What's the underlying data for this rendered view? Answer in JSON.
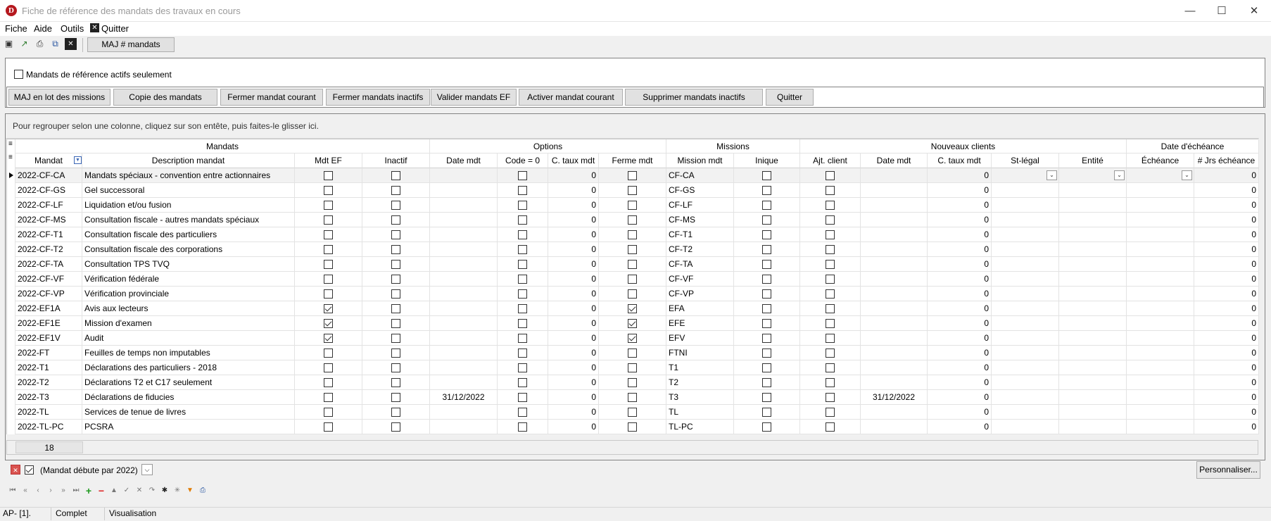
{
  "window": {
    "title": "Fiche de référence des mandats des travaux en cours",
    "logo": "D"
  },
  "menu": {
    "fiche": "Fiche",
    "aide": "Aide",
    "outils": "Outils",
    "quitter": "Quitter"
  },
  "toolbar": {
    "maj_label": "MAJ # mandats"
  },
  "filter": {
    "checkbox_label": "Mandats de référence actifs seulement",
    "checked": false
  },
  "actions": [
    "MAJ en lot des missions",
    "Copie des mandats",
    "Fermer mandat courant",
    "Fermer mandats inactifs",
    "Valider mandats EF",
    "Activer mandat courant",
    "Supprimer mandats inactifs",
    "Quitter"
  ],
  "grid": {
    "group_hint": "Pour regrouper selon une colonne, cliquez sur son entête, puis faites-le glisser ici.",
    "bands": [
      "Mandats",
      "Options",
      "Missions",
      "Nouveaux clients",
      "Date d'échéance"
    ],
    "columns": [
      "Mandat",
      "Description mandat",
      "Mdt EF",
      "Inactif",
      "Date mdt",
      "Code = 0",
      "C. taux mdt",
      "Ferme mdt",
      "Mission mdt",
      "Inique",
      "Ajt. client",
      "Date mdt",
      "C. taux mdt",
      "St-légal",
      "Entité",
      "Échéance",
      "# Jrs échéance"
    ],
    "rows": [
      {
        "mandat": "2022-CF-CA",
        "desc": "Mandats spéciaux - convention entre actionnaires",
        "ef": false,
        "date": "",
        "ferme": false,
        "mission": "CF-CA",
        "date2": ""
      },
      {
        "mandat": "2022-CF-GS",
        "desc": "Gel successoral",
        "ef": false,
        "date": "",
        "ferme": false,
        "mission": "CF-GS",
        "date2": ""
      },
      {
        "mandat": "2022-CF-LF",
        "desc": "Liquidation et/ou fusion",
        "ef": false,
        "date": "",
        "ferme": false,
        "mission": "CF-LF",
        "date2": ""
      },
      {
        "mandat": "2022-CF-MS",
        "desc": "Consultation fiscale - autres mandats spéciaux",
        "ef": false,
        "date": "",
        "ferme": false,
        "mission": "CF-MS",
        "date2": ""
      },
      {
        "mandat": "2022-CF-T1",
        "desc": "Consultation fiscale des particuliers",
        "ef": false,
        "date": "",
        "ferme": false,
        "mission": "CF-T1",
        "date2": ""
      },
      {
        "mandat": "2022-CF-T2",
        "desc": "Consultation fiscale des corporations",
        "ef": false,
        "date": "",
        "ferme": false,
        "mission": "CF-T2",
        "date2": ""
      },
      {
        "mandat": "2022-CF-TA",
        "desc": "Consultation TPS TVQ",
        "ef": false,
        "date": "",
        "ferme": false,
        "mission": "CF-TA",
        "date2": ""
      },
      {
        "mandat": "2022-CF-VF",
        "desc": "Vérification fédérale",
        "ef": false,
        "date": "",
        "ferme": false,
        "mission": "CF-VF",
        "date2": ""
      },
      {
        "mandat": "2022-CF-VP",
        "desc": "Vérification provinciale",
        "ef": false,
        "date": "",
        "ferme": false,
        "mission": "CF-VP",
        "date2": ""
      },
      {
        "mandat": "2022-EF1A",
        "desc": "Avis aux lecteurs",
        "ef": true,
        "date": "",
        "ferme": true,
        "mission": "EFA",
        "date2": ""
      },
      {
        "mandat": "2022-EF1E",
        "desc": "Mission d'examen",
        "ef": true,
        "date": "",
        "ferme": true,
        "mission": "EFE",
        "date2": ""
      },
      {
        "mandat": "2022-EF1V",
        "desc": "Audit",
        "ef": true,
        "date": "",
        "ferme": true,
        "mission": "EFV",
        "date2": ""
      },
      {
        "mandat": "2022-FT",
        "desc": "Feuilles de temps non imputables",
        "ef": false,
        "date": "",
        "ferme": false,
        "mission": "FTNI",
        "date2": ""
      },
      {
        "mandat": "2022-T1",
        "desc": "Déclarations des particuliers - 2018",
        "ef": false,
        "date": "",
        "ferme": false,
        "mission": "T1",
        "date2": ""
      },
      {
        "mandat": "2022-T2",
        "desc": "Déclarations T2 et C17 seulement",
        "ef": false,
        "date": "",
        "ferme": false,
        "mission": "T2",
        "date2": ""
      },
      {
        "mandat": "2022-T3",
        "desc": "Déclarations de fiducies",
        "ef": false,
        "date": "31/12/2022",
        "ferme": false,
        "mission": "T3",
        "date2": "31/12/2022"
      },
      {
        "mandat": "2022-TL",
        "desc": "Services de tenue de livres",
        "ef": false,
        "date": "",
        "ferme": false,
        "mission": "TL",
        "date2": ""
      },
      {
        "mandat": "2022-TL-PC",
        "desc": "PCSRA",
        "ef": false,
        "date": "",
        "ferme": false,
        "mission": "TL-PC",
        "date2": ""
      }
    ],
    "zero": "0",
    "count": "18",
    "filter_text": "(Mandat débute par 2022)",
    "customize": "Personnaliser..."
  },
  "statusbar": {
    "left": "AP- [1].",
    "mode": "Complet",
    "view": "Visualisation"
  },
  "icons": [
    "minimize-icon",
    "maximize-icon",
    "close-icon",
    "new-icon",
    "export-icon",
    "print-icon",
    "copy-icon",
    "delete-icon",
    "filter-icon"
  ]
}
